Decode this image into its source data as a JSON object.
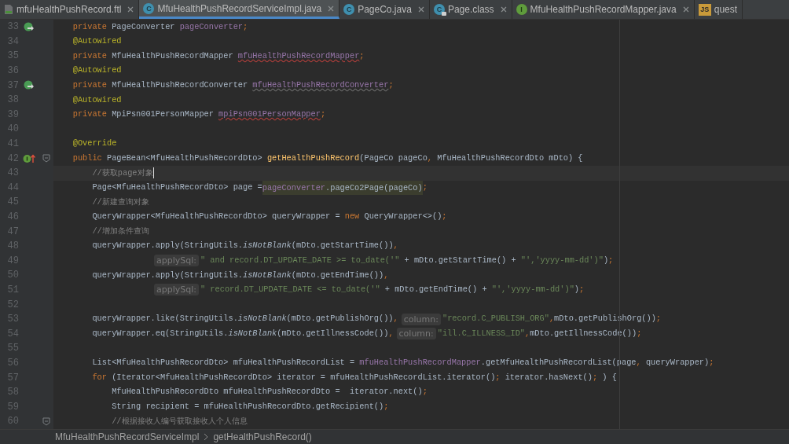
{
  "tabs": [
    {
      "label": "mfuHealthPushRecord.ftl",
      "icon": {
        "kind": "file"
      },
      "selected": false
    },
    {
      "label": "MfuHealthPushRecordServiceImpl.java",
      "icon": {
        "kind": "class",
        "letter": "C"
      },
      "selected": true
    },
    {
      "label": "PageCo.java",
      "icon": {
        "kind": "class",
        "letter": "C"
      },
      "selected": false
    },
    {
      "label": "Page.class",
      "icon": {
        "kind": "locked-class",
        "letter": "C"
      },
      "selected": false
    },
    {
      "label": "MfuHealthPushRecordMapper.java",
      "icon": {
        "kind": "interface",
        "letter": "I"
      },
      "selected": false
    },
    {
      "label": "quest",
      "icon": {
        "kind": "script",
        "letter": "JS"
      },
      "selected": false
    }
  ],
  "editor": {
    "lines": [
      {
        "number": "33",
        "current": false,
        "gutter": {
          "kind": "bean"
        },
        "tokens": [
          {
            "text": "    private",
            "kind": "keyword"
          },
          {
            "text": " PageConverter ",
            "kind": "plain"
          },
          {
            "text": "pageConverter",
            "kind": "field"
          },
          {
            "text": ";",
            "kind": "punct"
          }
        ]
      },
      {
        "number": "34",
        "current": false,
        "tokens": [
          {
            "text": "    @Autowired",
            "kind": "annotation"
          }
        ]
      },
      {
        "number": "35",
        "current": false,
        "tokens": [
          {
            "text": "    private",
            "kind": "keyword"
          },
          {
            "text": " MfuHealthPushRecordMapper ",
            "kind": "plain"
          },
          {
            "text": "mfuHealthPushRecordMapper",
            "kind": "field-error"
          },
          {
            "text": ";",
            "kind": "punct"
          }
        ]
      },
      {
        "number": "36",
        "current": false,
        "tokens": [
          {
            "text": "    @Autowired",
            "kind": "annotation"
          }
        ]
      },
      {
        "number": "37",
        "current": false,
        "gutter": {
          "kind": "bean"
        },
        "tokens": [
          {
            "text": "    private",
            "kind": "keyword"
          },
          {
            "text": " MfuHealthPushRecordConverter ",
            "kind": "plain"
          },
          {
            "text": "mfuHealthPushRecordConverter",
            "kind": "field-unused"
          },
          {
            "text": ";",
            "kind": "punct"
          }
        ]
      },
      {
        "number": "38",
        "current": false,
        "tokens": [
          {
            "text": "    @Autowired",
            "kind": "annotation"
          }
        ]
      },
      {
        "number": "39",
        "current": false,
        "tokens": [
          {
            "text": "    private",
            "kind": "keyword"
          },
          {
            "text": " MpiPsn001PersonMapper ",
            "kind": "plain"
          },
          {
            "text": "mpiPsn001PersonMapper",
            "kind": "field-error"
          },
          {
            "text": ";",
            "kind": "punct"
          }
        ]
      },
      {
        "number": "40",
        "current": false
      },
      {
        "number": "41",
        "current": false,
        "tokens": [
          {
            "text": "    @Override",
            "kind": "annotation"
          }
        ]
      },
      {
        "number": "42",
        "current": false,
        "foldable": true,
        "gutter": {
          "kind": "implements"
        },
        "tokens": [
          {
            "text": "    public",
            "kind": "keyword"
          },
          {
            "text": " PageBean<MfuHealthPushRecordDto> ",
            "kind": "plain"
          },
          {
            "text": "getHealthPushRecord",
            "kind": "method"
          },
          {
            "text": "(PageCo pageCo",
            "kind": "plain"
          },
          {
            "text": ",",
            "kind": "punct"
          },
          {
            "text": " MfuHealthPushRecordDto mDto) {",
            "kind": "plain"
          }
        ]
      },
      {
        "number": "43",
        "current": true,
        "tokens": [
          {
            "text": "        //获取page对象",
            "kind": "comment"
          }
        ]
      },
      {
        "number": "44",
        "current": false,
        "tokens": [
          {
            "text": "        Page<MfuHealthPushRecordDto> page =",
            "kind": "plain"
          },
          {
            "text": "pageConverter",
            "kind": "field",
            "highlighted": true
          },
          {
            "text": ".pageCo2Page(pageCo)",
            "kind": "plain",
            "highlighted": true
          },
          {
            "text": ";",
            "kind": "punct"
          }
        ]
      },
      {
        "number": "45",
        "current": false,
        "tokens": [
          {
            "text": "        //新建查询对象",
            "kind": "comment"
          }
        ]
      },
      {
        "number": "46",
        "current": false,
        "tokens": [
          {
            "text": "        QueryWrapper<MfuHealthPushRecordDto> queryWrapper = ",
            "kind": "plain"
          },
          {
            "text": "new",
            "kind": "keyword"
          },
          {
            "text": " QueryWrapper<>()",
            "kind": "plain"
          },
          {
            "text": ";",
            "kind": "punct"
          }
        ]
      },
      {
        "number": "47",
        "current": false,
        "tokens": [
          {
            "text": "        //增加条件查询",
            "kind": "comment"
          }
        ]
      },
      {
        "number": "48",
        "current": false,
        "tokens": [
          {
            "text": "        queryWrapper.apply(StringUtils.",
            "kind": "plain"
          },
          {
            "text": "isNotBlank",
            "kind": "static"
          },
          {
            "text": "(mDto.getStartTime())",
            "kind": "plain"
          },
          {
            "text": ",",
            "kind": "punct"
          }
        ]
      },
      {
        "number": "49",
        "current": false,
        "continuation": true,
        "tokens": [
          {
            "text": "applySql:",
            "kind": "hint"
          },
          {
            "text": "\" and record.DT_UPDATE_DATE >= to_date('\"",
            "kind": "string"
          },
          {
            "text": " + mDto.getStartTime() + ",
            "kind": "plain"
          },
          {
            "text": "\"','yyyy-mm-dd')\"",
            "kind": "string"
          },
          {
            "text": ")",
            "kind": "plain"
          },
          {
            "text": ";",
            "kind": "punct"
          }
        ]
      },
      {
        "number": "50",
        "current": false,
        "tokens": [
          {
            "text": "        queryWrapper.apply(StringUtils.",
            "kind": "plain"
          },
          {
            "text": "isNotBlank",
            "kind": "static"
          },
          {
            "text": "(mDto.getEndTime())",
            "kind": "plain"
          },
          {
            "text": ",",
            "kind": "punct"
          }
        ]
      },
      {
        "number": "51",
        "current": false,
        "continuation": true,
        "tokens": [
          {
            "text": "applySql:",
            "kind": "hint"
          },
          {
            "text": "\" record.DT_UPDATE_DATE <= to_date('\"",
            "kind": "string"
          },
          {
            "text": " + mDto.getEndTime() + ",
            "kind": "plain"
          },
          {
            "text": "\"','yyyy-mm-dd')\"",
            "kind": "string"
          },
          {
            "text": ")",
            "kind": "plain"
          },
          {
            "text": ";",
            "kind": "punct"
          }
        ]
      },
      {
        "number": "52",
        "current": false
      },
      {
        "number": "53",
        "current": false,
        "tokens": [
          {
            "text": "        queryWrapper.like(StringUtils.",
            "kind": "plain"
          },
          {
            "text": "isNotBlank",
            "kind": "static"
          },
          {
            "text": "(mDto.getPublishOrg())",
            "kind": "plain"
          },
          {
            "text": ",",
            "kind": "punct"
          },
          {
            "text": "column:",
            "kind": "hint"
          },
          {
            "text": "\"record.C_PUBLISH_ORG\"",
            "kind": "string"
          },
          {
            "text": ",",
            "kind": "punct"
          },
          {
            "text": "mDto.getPublishOrg())",
            "kind": "plain"
          },
          {
            "text": ";",
            "kind": "punct"
          }
        ]
      },
      {
        "number": "54",
        "current": false,
        "tokens": [
          {
            "text": "        queryWrapper.eq(StringUtils.",
            "kind": "plain"
          },
          {
            "text": "isNotBlank",
            "kind": "static"
          },
          {
            "text": "(mDto.getIllnessCode())",
            "kind": "plain"
          },
          {
            "text": ",",
            "kind": "punct"
          },
          {
            "text": "column:",
            "kind": "hint"
          },
          {
            "text": "\"ill.C_ILLNESS_ID\"",
            "kind": "string"
          },
          {
            "text": ",",
            "kind": "punct"
          },
          {
            "text": "mDto.getIllnessCode())",
            "kind": "plain"
          },
          {
            "text": ";",
            "kind": "punct"
          }
        ]
      },
      {
        "number": "55",
        "current": false
      },
      {
        "number": "56",
        "current": false,
        "tokens": [
          {
            "text": "        List<MfuHealthPushRecordDto> mfuHealthPushRecordList = ",
            "kind": "plain"
          },
          {
            "text": "mfuHealthPushRecordMapper",
            "kind": "field"
          },
          {
            "text": ".getMfuHealthPushRecordList(page",
            "kind": "plain"
          },
          {
            "text": ",",
            "kind": "punct"
          },
          {
            "text": " queryWrapper)",
            "kind": "plain"
          },
          {
            "text": ";",
            "kind": "punct"
          }
        ]
      },
      {
        "number": "57",
        "current": false,
        "tokens": [
          {
            "text": "        for",
            "kind": "keyword"
          },
          {
            "text": " (Iterator<MfuHealthPushRecordDto> iterator = mfuHealthPushRecordList.iterator()",
            "kind": "plain"
          },
          {
            "text": ";",
            "kind": "punct"
          },
          {
            "text": " iterator.hasNext()",
            "kind": "plain"
          },
          {
            "text": ";",
            "kind": "punct"
          },
          {
            "text": " ) {",
            "kind": "plain"
          }
        ]
      },
      {
        "number": "58",
        "current": false,
        "tokens": [
          {
            "text": "            MfuHealthPushRecordDto mfuHealthPushRecordDto =  iterator.next()",
            "kind": "plain"
          },
          {
            "text": ";",
            "kind": "punct"
          }
        ]
      },
      {
        "number": "59",
        "current": false,
        "tokens": [
          {
            "text": "            String recipient = mfuHealthPushRecordDto.getRecipient()",
            "kind": "plain"
          },
          {
            "text": ";",
            "kind": "punct"
          }
        ]
      },
      {
        "number": "60",
        "current": false,
        "foldable": true,
        "tokens": [
          {
            "text": "            //根据接收人编号获取接收人个人信息",
            "kind": "comment"
          }
        ]
      }
    ]
  },
  "breadcrumb": [
    "MfuHealthPushRecordServiceImpl",
    "getHealthPushRecord()"
  ]
}
